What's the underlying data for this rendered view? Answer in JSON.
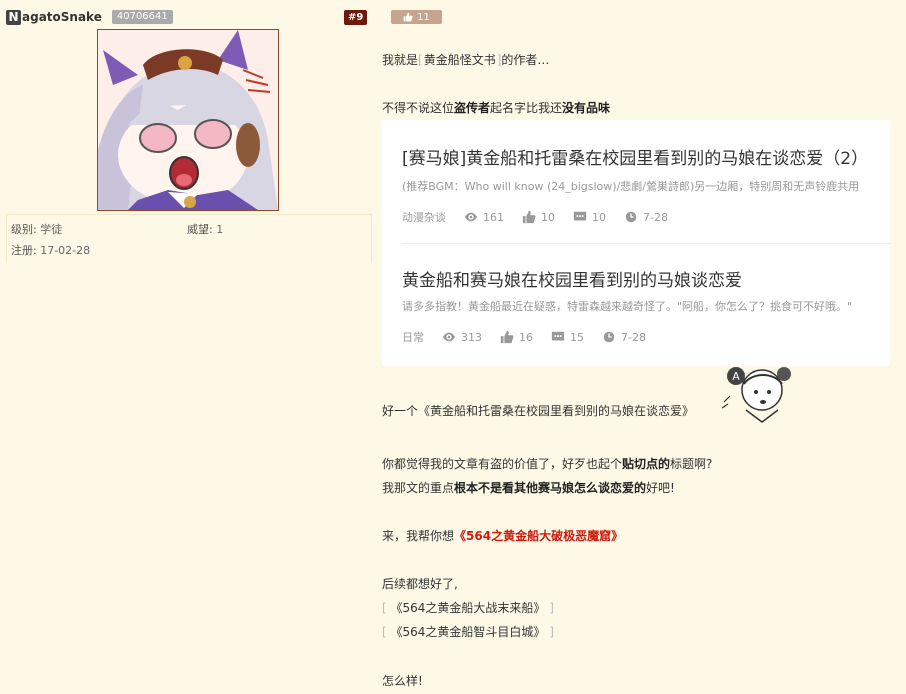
{
  "user": {
    "initial": "N",
    "name_rest": "agatoSnake",
    "uid": "40706641",
    "level_label": "级别:",
    "level_value": "学徒",
    "prestige_label": "威望:",
    "prestige_value": "1",
    "register_label": "注册:",
    "register_value": "17-02-28"
  },
  "post": {
    "floor": "#9",
    "likes": "11",
    "lines": {
      "l1_prefix": "我就是",
      "l1_link": "黄金船怪文书",
      "l1_suffix": "的作者…",
      "l2_a": "不得不说这位",
      "l2_b": "盗传者",
      "l2_c": "起名字比我还",
      "l2_d": "没有品味",
      "l3": "好一个《黄金船和托雷桑在校园里看到别的马娘在谈恋爱》",
      "l4_a": "你都觉得我的文章有盗的价值了，好歹也起个",
      "l4_b": "贴切点的",
      "l4_c": "标题啊?",
      "l5_a": "我那文的重点",
      "l5_b": "根本不是看其他赛马娘怎么谈恋爱的",
      "l5_c": "好吧!",
      "l6_a": "来，我帮你想",
      "l6_b": "《564之黄金船大破极恶魔窟》",
      "l7": "后续都想好了,",
      "l8": "《564之黄金船大战末来船》",
      "l9": "《564之黄金船智斗目白城》",
      "l10": "怎么样!"
    }
  },
  "card": {
    "items": [
      {
        "title": "[赛马娘]黄金船和托雷桑在校园里看到别的马娘在谈恋爱（2）",
        "desc": "(推荐BGM：Who will know (24_bigslow)/悲劇/鶯巣詩郎)另一边厢，特别周和无声铃鹿共用",
        "category": "动漫杂谈",
        "views": "161",
        "likes": "10",
        "comments": "10",
        "date": "7-28"
      },
      {
        "title": "黄金船和赛马娘在校园里看到别的马娘谈恋爱",
        "desc": "请多多指教！黄金船最近在疑惑，特雷森越来越奇怪了。\"阿船，你怎么了？挑食可不好哦。\"",
        "category": "日常",
        "views": "313",
        "likes": "16",
        "comments": "15",
        "date": "7-28"
      }
    ]
  },
  "colors": {
    "background": "#fef8e6",
    "floor_badge": "#6b1a0c",
    "like_badge": "#c7a48e",
    "accent_red": "#cc1b0c"
  },
  "icons": [
    "thumb-up-icon",
    "eye-icon",
    "comment-icon",
    "clock-icon"
  ]
}
